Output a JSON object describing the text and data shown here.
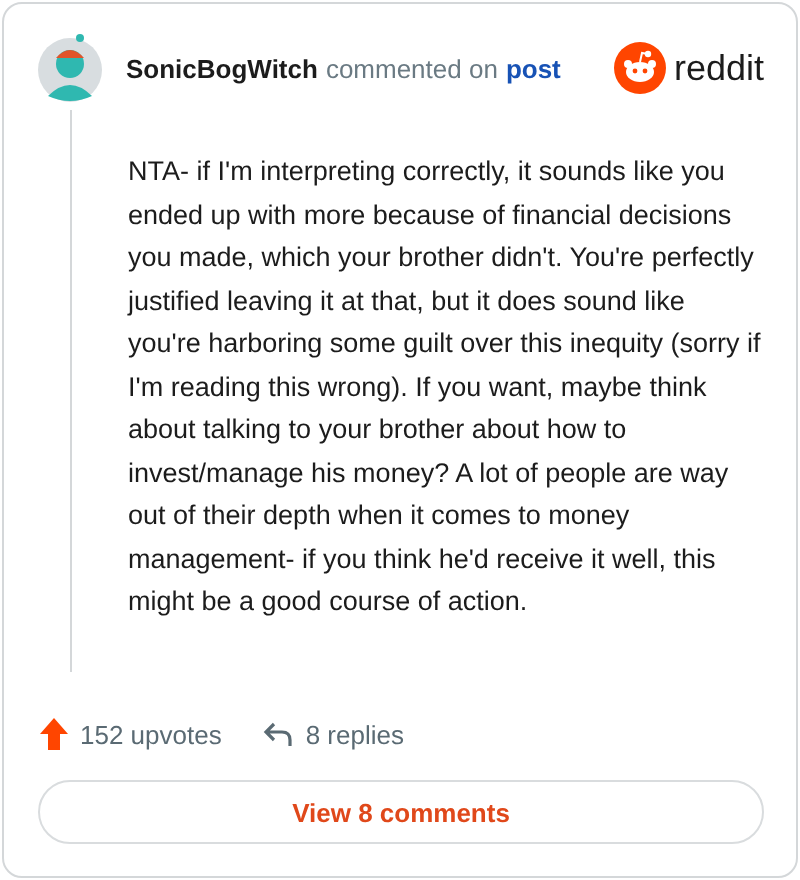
{
  "comment": {
    "author": "SonicBogWitch",
    "action": "commented on",
    "link": "post",
    "brand": "reddit",
    "body": "NTA- if I'm interpreting correctly, it sounds like you ended up with more because of financial decisions you made, which your brother didn't. You're perfectly justified leaving it at that, but it does sound like you're harboring some guilt over this inequity (sorry if I'm reading this wrong). If you want, maybe think about talking to your brother about how to invest/manage his money? A lot of people are way out of their depth when it comes to money management- if you think he'd receive it well, this might be a good course of action.",
    "upvotes": "152 upvotes",
    "replies": "8 replies",
    "button": "View 8 comments"
  }
}
